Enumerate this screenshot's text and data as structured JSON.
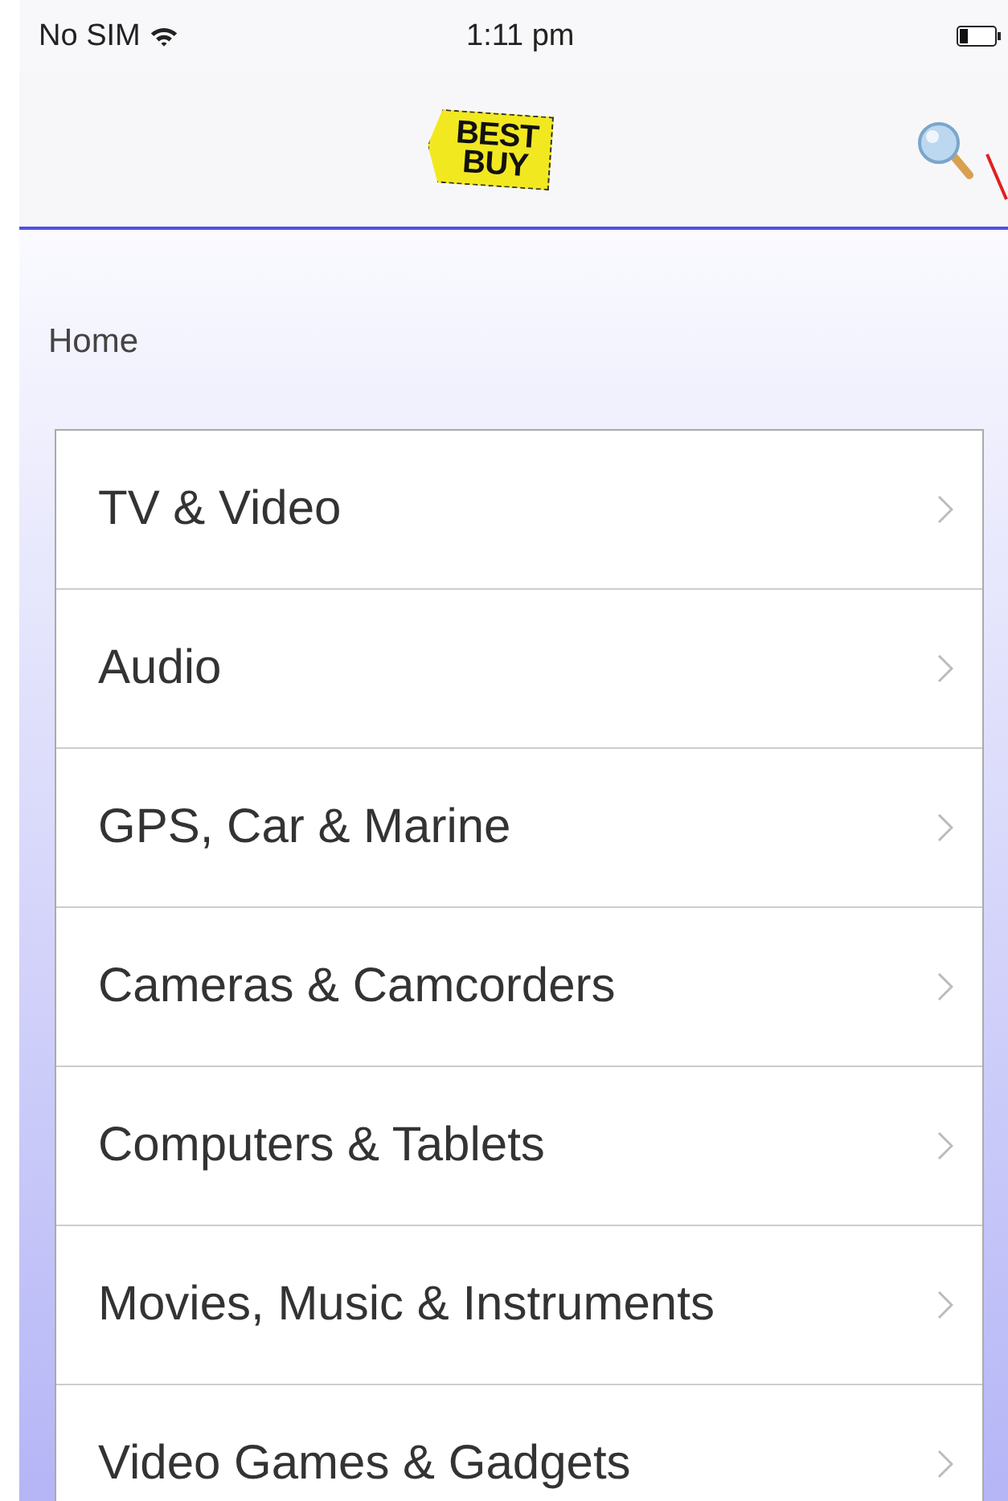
{
  "status_bar": {
    "carrier": "No SIM",
    "time": "1:11 pm"
  },
  "nav_bar": {
    "logo": {
      "line_1": "BEST",
      "line_2": "BUY"
    }
  },
  "breadcrumb": "Home",
  "categories": [
    {
      "label": "TV & Video"
    },
    {
      "label": "Audio"
    },
    {
      "label": "GPS, Car & Marine"
    },
    {
      "label": "Cameras & Camcorders"
    },
    {
      "label": "Computers & Tablets"
    },
    {
      "label": "Movies, Music & Instruments"
    },
    {
      "label": "Video Games & Gadgets"
    }
  ]
}
